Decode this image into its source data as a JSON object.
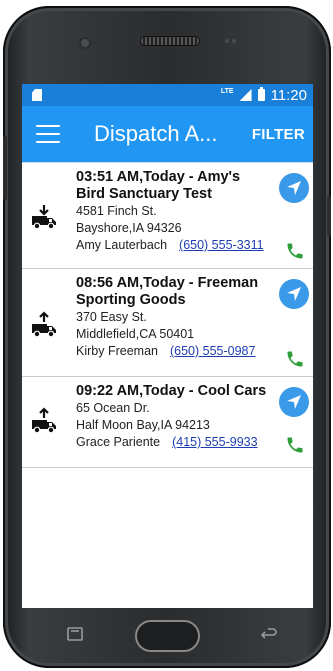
{
  "status_bar": {
    "network": "LTE",
    "time": "11:20"
  },
  "app_bar": {
    "title": "Dispatch A...",
    "filter_label": "FILTER"
  },
  "colors": {
    "status_bar": "#1a7fd9",
    "app_bar": "#2196f3",
    "navigate_button": "#3a99e8",
    "call_icon": "#2e9e3a",
    "phone_link": "#1d3fb3"
  },
  "dispatches": [
    {
      "type_icon": "truck-delivery-icon",
      "title": "03:51 AM,Today - Amy's Bird Sanctuary Test",
      "address": "4581 Finch St.",
      "city_line": "Bayshore,IA  94326",
      "contact": "Amy Lauterbach",
      "phone": "(650) 555-3311"
    },
    {
      "type_icon": "truck-pickup-icon",
      "title": "08:56 AM,Today - Freeman Sporting Goods",
      "address": "370 Easy St.",
      "city_line": "Middlefield,CA  50401",
      "contact": "Kirby Freeman",
      "phone": "(650) 555-0987"
    },
    {
      "type_icon": "truck-pickup-icon",
      "title": "09:22 AM,Today - Cool Cars",
      "address": "65 Ocean Dr.",
      "city_line": "Half Moon Bay,IA  94213",
      "contact": "Grace Pariente",
      "phone": "(415) 555-9933"
    }
  ]
}
